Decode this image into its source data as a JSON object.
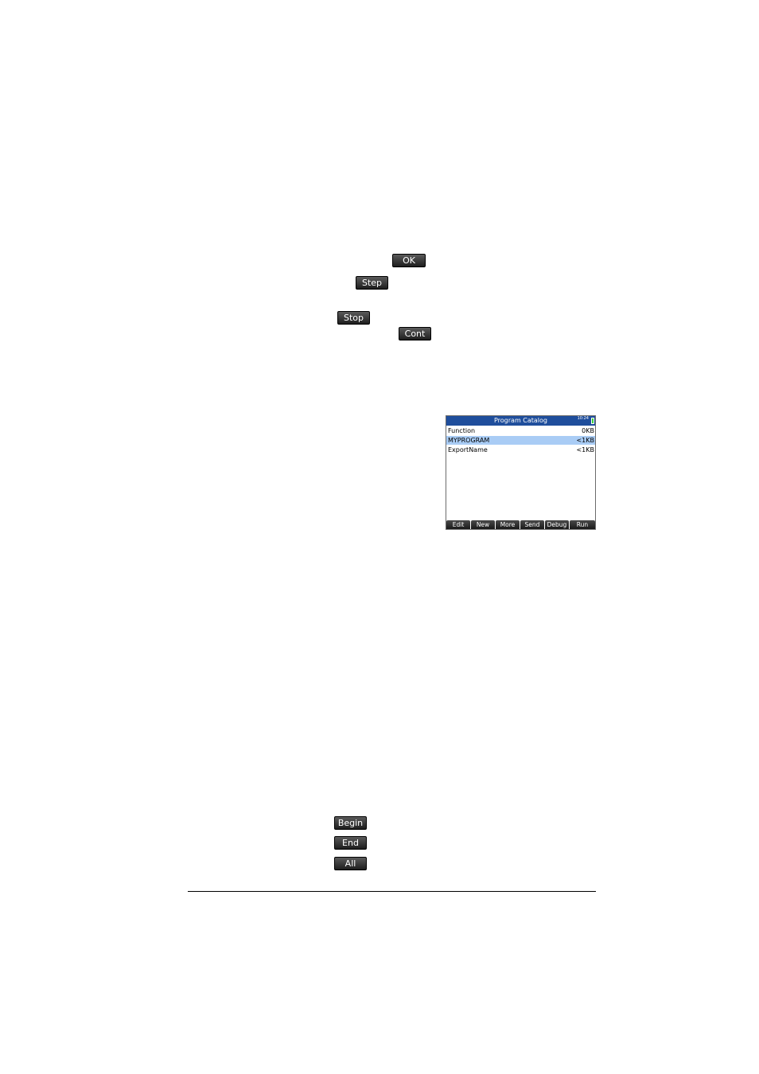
{
  "softkeys": {
    "ok": "OK",
    "step": "Step",
    "stop": "Stop",
    "cont": "Cont",
    "begin": "Begin",
    "end": "End",
    "all": "All"
  },
  "screenshot": {
    "title": "Program Catalog",
    "clock": "10:24",
    "programs": [
      {
        "name": "Function",
        "size": "0KB",
        "selected": false
      },
      {
        "name": "MYPROGRAM",
        "size": "<1KB",
        "selected": true
      },
      {
        "name": "ExportName",
        "size": "<1KB",
        "selected": false
      }
    ],
    "menu": [
      "Edit",
      "New",
      "More",
      "Send",
      "Debug",
      "Run"
    ],
    "colors": {
      "title_bar": "#1f4e9c",
      "selection": "#a9ccf5",
      "battery": "#3ad23a"
    }
  }
}
